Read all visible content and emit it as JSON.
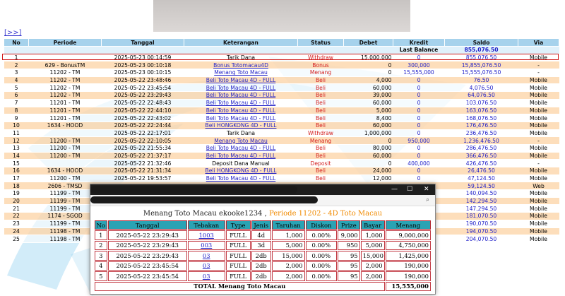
{
  "nav": {
    "more_link": "[>>]"
  },
  "table": {
    "headers": [
      "No",
      "Periode",
      "Tanggal",
      "Keterangan",
      "Status",
      "Debet",
      "Kredit",
      "Saldo",
      "Via"
    ],
    "last_balance_label": "Last Balance",
    "last_balance_value": "855,076.50",
    "rows": [
      {
        "no": "1",
        "periode": "",
        "tanggal": "2025-05-23 00:14:59",
        "ket": "Tarik Dana",
        "status": "Withdraw",
        "debet": "15,000,000",
        "kredit": "0",
        "saldo": "855,076.50",
        "via": "Mobile"
      },
      {
        "no": "2",
        "periode": "629 - BonusTM",
        "tanggal": "2025-05-23 00:10:18",
        "ket": "Bonus Totomacau4D",
        "status": "Bonus",
        "debet": "0",
        "kredit": "300,000",
        "saldo": "15,855,076.50",
        "via": "-"
      },
      {
        "no": "3",
        "periode": "11202 - TM",
        "tanggal": "2025-05-23 00:10:15",
        "ket": "Menang Toto Macau",
        "status": "Menang",
        "debet": "0",
        "kredit": "15,555,000",
        "saldo": "15,555,076.50",
        "via": "-"
      },
      {
        "no": "4",
        "periode": "11202 - TM",
        "tanggal": "2025-05-22 23:48:46",
        "ket": "Beli Toto Macau 4D - FULL",
        "status": "Beli",
        "debet": "4,000",
        "kredit": "0",
        "saldo": "76.50",
        "via": "Mobile"
      },
      {
        "no": "5",
        "periode": "11202 - TM",
        "tanggal": "2025-05-22 23:45:54",
        "ket": "Beli Toto Macau 4D - FULL",
        "status": "Beli",
        "debet": "60,000",
        "kredit": "0",
        "saldo": "4,076.50",
        "via": "Mobile"
      },
      {
        "no": "6",
        "periode": "11202 - TM",
        "tanggal": "2025-05-22 23:29:43",
        "ket": "Beli Toto Macau 4D - FULL",
        "status": "Beli",
        "debet": "39,000",
        "kredit": "0",
        "saldo": "64,076.50",
        "via": "Mobile"
      },
      {
        "no": "7",
        "periode": "11201 - TM",
        "tanggal": "2025-05-22 22:48:43",
        "ket": "Beli Toto Macau 4D - FULL",
        "status": "Beli",
        "debet": "60,000",
        "kredit": "0",
        "saldo": "103,076.50",
        "via": "Mobile"
      },
      {
        "no": "8",
        "periode": "11201 - TM",
        "tanggal": "2025-05-22 22:44:10",
        "ket": "Beli Toto Macau 4D - FULL",
        "status": "Beli",
        "debet": "5,000",
        "kredit": "0",
        "saldo": "163,076.50",
        "via": "Mobile"
      },
      {
        "no": "9",
        "periode": "11201 - TM",
        "tanggal": "2025-05-22 22:43:02",
        "ket": "Beli Toto Macau 4D - FULL",
        "status": "Beli",
        "debet": "8,400",
        "kredit": "0",
        "saldo": "168,076.50",
        "via": "Mobile"
      },
      {
        "no": "10",
        "periode": "1634 - HOOD",
        "tanggal": "2025-05-22 22:24:44",
        "ket": "Beli HONGKONG 4D - FULL",
        "status": "Beli",
        "debet": "60,000",
        "kredit": "0",
        "saldo": "176,476.50",
        "via": "Mobile"
      },
      {
        "no": "11",
        "periode": "",
        "tanggal": "2025-05-22 22:17:01",
        "ket": "Tarik Dana",
        "status": "Withdraw",
        "debet": "1,000,000",
        "kredit": "0",
        "saldo": "236,476.50",
        "via": "Mobile"
      },
      {
        "no": "12",
        "periode": "11200 - TM",
        "tanggal": "2025-05-22 22:10:05",
        "ket": "Menang Toto Macau",
        "status": "Menang",
        "debet": "0",
        "kredit": "950,000",
        "saldo": "1,236,476.50",
        "via": "-"
      },
      {
        "no": "13",
        "periode": "11200 - TM",
        "tanggal": "2025-05-22 21:55:34",
        "ket": "Beli Toto Macau 4D - FULL",
        "status": "Beli",
        "debet": "80,000",
        "kredit": "0",
        "saldo": "286,476.50",
        "via": "Mobile"
      },
      {
        "no": "14",
        "periode": "11200 - TM",
        "tanggal": "2025-05-22 21:37:17",
        "ket": "Beli Toto Macau 4D - FULL",
        "status": "Beli",
        "debet": "60,000",
        "kredit": "0",
        "saldo": "366,476.50",
        "via": "Mobile"
      },
      {
        "no": "15",
        "periode": "",
        "tanggal": "2025-05-22 21:32:46",
        "ket": "Deposit Dana Manual",
        "status": "Deposit",
        "debet": "0",
        "kredit": "400,000",
        "saldo": "426,476.50",
        "via": "-"
      },
      {
        "no": "16",
        "periode": "1634 - HOOD",
        "tanggal": "2025-05-22 21:31:34",
        "ket": "Beli HONGKONG 4D - FULL",
        "status": "Beli",
        "debet": "24,000",
        "kredit": "0",
        "saldo": "26,476.50",
        "via": "Mobile"
      },
      {
        "no": "17",
        "periode": "11200 - TM",
        "tanggal": "2025-05-22 19:53:57",
        "ket": "Beli Toto Macau 4D - FULL",
        "status": "Beli",
        "debet": "12,000",
        "kredit": "0",
        "saldo": "47,124.50",
        "via": "Mobile"
      },
      {
        "no": "18",
        "periode": "2606 - TMSD",
        "tanggal": "",
        "ket": "",
        "status": "",
        "debet": "",
        "kredit": "0",
        "saldo": "59,124.50",
        "via": "Web"
      },
      {
        "no": "19",
        "periode": "11199 - TM",
        "tanggal": "",
        "ket": "",
        "status": "",
        "debet": "",
        "kredit": "0",
        "saldo": "140,094.50",
        "via": "Mobile"
      },
      {
        "no": "20",
        "periode": "11199 - TM",
        "tanggal": "",
        "ket": "",
        "status": "",
        "debet": "",
        "kredit": "0",
        "saldo": "142,294.50",
        "via": "Mobile"
      },
      {
        "no": "21",
        "periode": "11199 - TM",
        "tanggal": "",
        "ket": "",
        "status": "",
        "debet": "",
        "kredit": "0",
        "saldo": "147,294.50",
        "via": "Mobile"
      },
      {
        "no": "22",
        "periode": "1174 - SGOD",
        "tanggal": "",
        "ket": "",
        "status": "",
        "debet": "",
        "kredit": "0",
        "saldo": "181,070.50",
        "via": "Mobile"
      },
      {
        "no": "23",
        "periode": "11199 - TM",
        "tanggal": "",
        "ket": "",
        "status": "",
        "debet": "",
        "kredit": "0",
        "saldo": "190,070.50",
        "via": "Mobile"
      },
      {
        "no": "24",
        "periode": "11198 - TM",
        "tanggal": "",
        "ket": "",
        "status": "",
        "debet": "",
        "kredit": "0",
        "saldo": "194,070.50",
        "via": "Mobile"
      },
      {
        "no": "25",
        "periode": "11198 - TM",
        "tanggal": "",
        "ket": "",
        "status": "",
        "debet": "",
        "kredit": "0",
        "saldo": "204,070.50",
        "via": "Mobile"
      }
    ]
  },
  "popup": {
    "window_controls": {
      "minimize": "—",
      "maximize": "☐",
      "close": "✕"
    },
    "zoom_icon": "⌕",
    "heading_main": "Menang Toto Macau ekooke1234 ,",
    "heading_period": "Periode 11202 - 4D Toto Macau",
    "headers": [
      "No",
      "Tanggal",
      "Tebakan",
      "Type",
      "Jenis",
      "Taruhan",
      "Diskon",
      "Prize",
      "Bayar",
      "Menang"
    ],
    "rows": [
      {
        "no": "1",
        "tanggal": "2025-05-22 23:29:43",
        "tebakan": "1003",
        "type": "FULL",
        "jenis": "4d",
        "taruhan": "1,000",
        "diskon": "0.00%",
        "prize": "9,000",
        "bayar": "1,000",
        "menang": "9,000,000"
      },
      {
        "no": "2",
        "tanggal": "2025-05-22 23:29:43",
        "tebakan": "003",
        "type": "FULL",
        "jenis": "3d",
        "taruhan": "5,000",
        "diskon": "0.00%",
        "prize": "950",
        "bayar": "5,000",
        "menang": "4,750,000"
      },
      {
        "no": "3",
        "tanggal": "2025-05-22 23:29:43",
        "tebakan": "03",
        "type": "FULL",
        "jenis": "2db",
        "taruhan": "15,000",
        "diskon": "0.00%",
        "prize": "95",
        "bayar": "15,000",
        "menang": "1,425,000"
      },
      {
        "no": "4",
        "tanggal": "2025-05-22 23:45:54",
        "tebakan": "03",
        "type": "FULL",
        "jenis": "2db",
        "taruhan": "2,000",
        "diskon": "0.00%",
        "prize": "95",
        "bayar": "2,000",
        "menang": "190,000"
      },
      {
        "no": "5",
        "tanggal": "2025-05-22 23:45:54",
        "tebakan": "03",
        "type": "FULL",
        "jenis": "2db",
        "taruhan": "2,000",
        "diskon": "0.00%",
        "prize": "95",
        "bayar": "2,000",
        "menang": "190,000"
      }
    ],
    "total_label": "TOTAL  Menang Toto Macau",
    "total_value": "15,555,000"
  }
}
